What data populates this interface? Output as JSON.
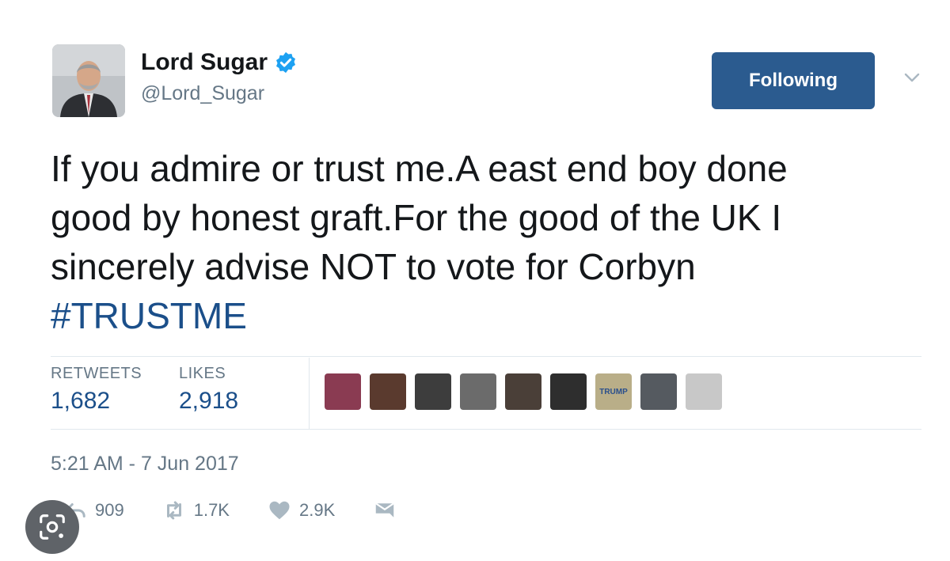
{
  "author": {
    "display_name": "Lord Sugar",
    "handle": "@Lord_Sugar",
    "avatar_icon": "profile-photo",
    "verified_icon": "verified-badge-icon"
  },
  "follow_button": {
    "label": "Following",
    "color": "#2b5b8f"
  },
  "menu_icon": "chevron-down-icon",
  "tweet": {
    "lines": [
      "If you admire or trust me.A east end boy done",
      "good by honest graft.For the good of the UK I",
      "sincerely advise NOT to vote for Corbyn"
    ],
    "hashtag": "#TRUSTME",
    "hashtag_color": "#1b4f8a"
  },
  "stats": {
    "retweets_label": "RETWEETS",
    "retweets_value": "1,682",
    "likes_label": "LIKES",
    "likes_value": "2,918"
  },
  "likers": [
    {
      "name": "liker-avatar-1",
      "color": "#8a3b52"
    },
    {
      "name": "liker-avatar-2",
      "color": "#5a3a2e"
    },
    {
      "name": "liker-avatar-3",
      "color": "#3d3d3d"
    },
    {
      "name": "liker-avatar-4",
      "color": "#6b6b6b"
    },
    {
      "name": "liker-avatar-5",
      "color": "#4a3f38"
    },
    {
      "name": "liker-avatar-6",
      "color": "#2e2e2e"
    },
    {
      "name": "liker-avatar-7",
      "color": "#b9ae88",
      "text": "TRUMP"
    },
    {
      "name": "liker-avatar-8",
      "color": "#555a60"
    },
    {
      "name": "liker-avatar-9",
      "color": "#c8c8c8"
    }
  ],
  "timestamp": "5:21 AM - 7 Jun 2017",
  "actions": {
    "reply_count": "909",
    "retweet_count": "1.7K",
    "like_count": "2.9K",
    "icons": [
      "reply-icon",
      "retweet-icon",
      "heart-icon",
      "direct-message-icon"
    ]
  },
  "overlay": {
    "icon": "lens-search-icon"
  }
}
